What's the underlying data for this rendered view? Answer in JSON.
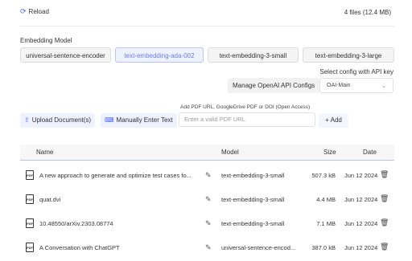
{
  "header": {
    "reload_label": "Reload",
    "file_count": "4 files (12.4 MB)"
  },
  "embedding": {
    "label": "Embedding Model",
    "models": [
      "universal-sentence-encoder",
      "text-embedding-ada-002",
      "text-embedding-3-small",
      "text-embedding-3-large"
    ],
    "selected": "text-embedding-ada-002"
  },
  "config": {
    "label": "Select config with API key",
    "manage_label": "Manage OpenAI API Configs",
    "selected": "OAI-Main"
  },
  "upload": {
    "pdf_label": "Add PDF URL, GoogleDrive PDF or DOI (Open Access)",
    "upload_label": "Upload Document(s)",
    "manual_label": "Manually Enter Text",
    "placeholder": "Enter a valid PDF URL",
    "add_label": "+ Add"
  },
  "table": {
    "headers": {
      "name": "Name",
      "model": "Model",
      "size": "Size",
      "date": "Date"
    },
    "rows": [
      {
        "name": "A new approach to generate and optimize test cases fo...",
        "model": "text-embedding-3-small",
        "size": "507.3 kB",
        "date": "Jun 12 2024"
      },
      {
        "name": "quat.dvi",
        "model": "text-embedding-3-small",
        "size": "4.4 MB",
        "date": "Jun 12 2024"
      },
      {
        "name": "10.48550/arXiv.2303.08774",
        "model": "text-embedding-3-small",
        "size": "7.1 MB",
        "date": "Jun 12 2024"
      },
      {
        "name": "A Conversation with ChatGPT",
        "model": "universal-sentence-encod...",
        "size": "387.0 kB",
        "date": "Jun 12 2024"
      }
    ]
  },
  "icons": {
    "reload": "reload-icon",
    "upload": "upload-icon",
    "keyboard": "keyboard-icon",
    "pdf": "pdf-file-icon",
    "edit": "pencil-icon",
    "delete": "trash-icon"
  },
  "colors": {
    "accent": "#4a6cf7",
    "active_bg": "#eef2ff"
  }
}
